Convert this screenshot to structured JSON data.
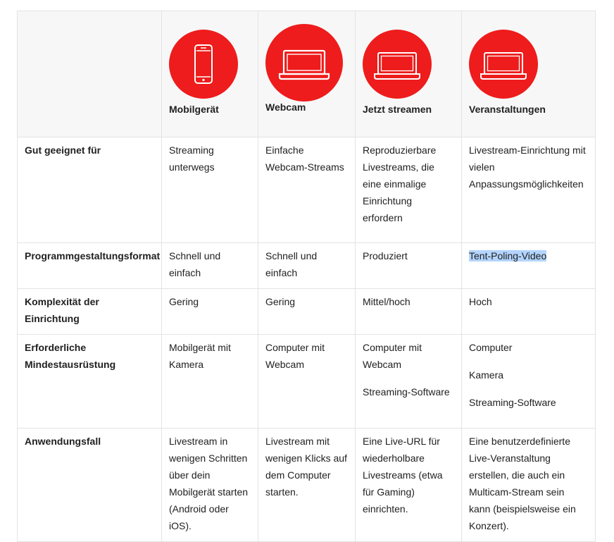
{
  "columns": [
    {
      "label": "Mobilgerät",
      "icon": "smartphone-icon"
    },
    {
      "label": "Webcam",
      "icon": "laptop-icon"
    },
    {
      "label": "Jetzt streamen",
      "icon": "laptop-icon"
    },
    {
      "label": "Veranstaltungen",
      "icon": "laptop-icon"
    }
  ],
  "rows": [
    {
      "label": "Gut geeignet für",
      "cells": [
        "Streaming unterwegs",
        "Einfache Webcam-Streams",
        "Reproduzierbare Livestreams, die eine einmalige Einrichtung erfordern",
        "Livestream-Einrichtung mit vielen Anpassungsmöglichkeiten"
      ]
    },
    {
      "label": "Programmgestaltungsformat",
      "cells": [
        "Schnell und einfach",
        "Schnell und einfach",
        "Produziert",
        "Tent-Poling-Video"
      ]
    },
    {
      "label": "Komplexität der Einrichtung",
      "cells": [
        "Gering",
        "Gering",
        "Mittel/hoch",
        "Hoch"
      ]
    },
    {
      "label": "Erforderliche Mindestausrüstung",
      "cells": [
        "Mobilgerät mit Kamera",
        "Computer mit Webcam",
        "Computer mit Webcam",
        "Computer"
      ],
      "extra": {
        "c3": [
          "Streaming-Software"
        ],
        "c4": [
          "Kamera",
          "Streaming-Software"
        ]
      }
    },
    {
      "label": "Anwendungsfall",
      "cells": [
        "Livestream in wenigen Schritten über dein Mobilgerät starten (Android oder iOS).",
        "Livestream mit wenigen Klicks auf dem Computer starten.",
        "Eine Live-URL für wiederholbare Livestreams (etwa für Gaming) einrichten.",
        "Eine benutzerdefinierte Live-Veranstaltung erstellen, die auch ein Multicam-Stream sein kann (beispielsweise ein Konzert)."
      ]
    }
  ],
  "accent_color": "#ee1c1c",
  "selection_color": "#b3d4fd"
}
